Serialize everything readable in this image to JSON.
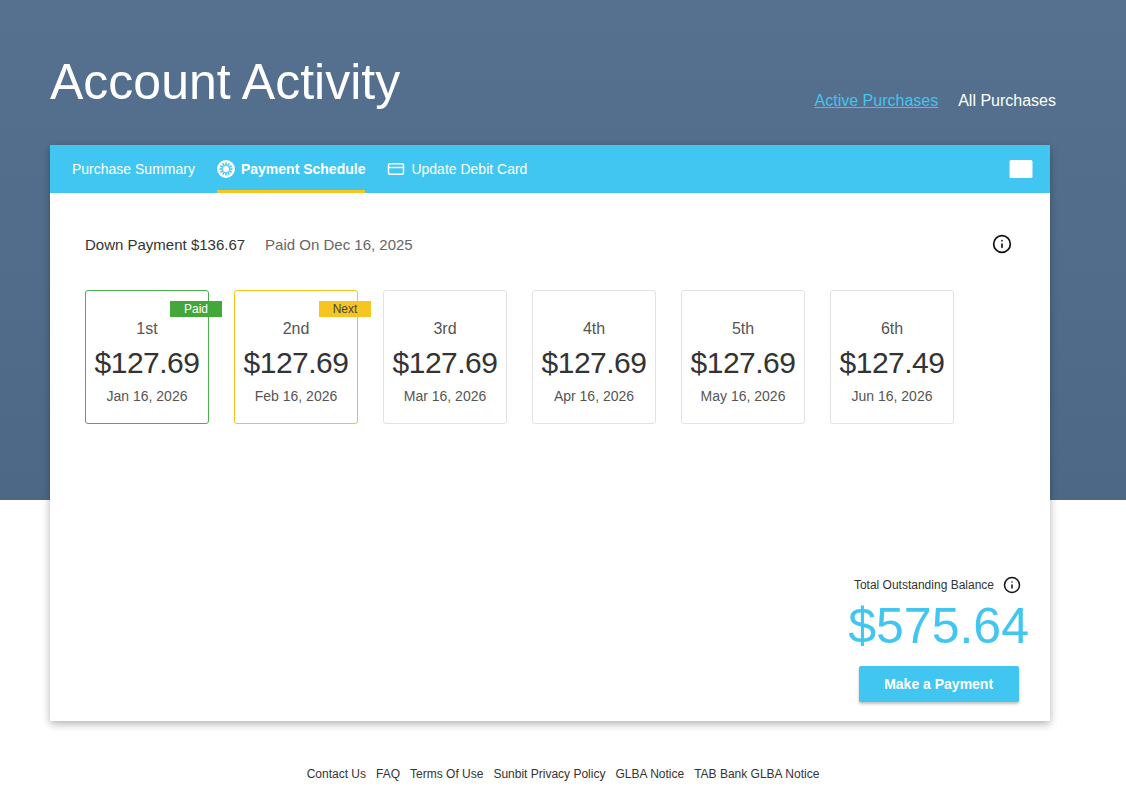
{
  "header": {
    "title": "Account Activity",
    "links": [
      {
        "label": "Active Purchases",
        "selected": true
      },
      {
        "label": "All Purchases",
        "selected": false
      }
    ]
  },
  "tabs": [
    {
      "label": "Purchase Summary",
      "selected": false,
      "icon": "none"
    },
    {
      "label": "Payment Schedule",
      "selected": true,
      "icon": "schedule"
    },
    {
      "label": "Update Debit Card",
      "selected": false,
      "icon": "card"
    }
  ],
  "down_payment": {
    "label": "Down Payment $136.67",
    "paid_on": "Paid On Dec 16, 2025"
  },
  "payments": [
    {
      "ordinal": "1st",
      "amount": "$127.69",
      "date": "Jan 16, 2026",
      "state": "paid",
      "badge": "Paid"
    },
    {
      "ordinal": "2nd",
      "amount": "$127.69",
      "date": "Feb 16, 2026",
      "state": "next",
      "badge": "Next"
    },
    {
      "ordinal": "3rd",
      "amount": "$127.69",
      "date": "Mar 16, 2026",
      "state": "upcoming",
      "badge": null
    },
    {
      "ordinal": "4th",
      "amount": "$127.69",
      "date": "Apr 16, 2026",
      "state": "upcoming",
      "badge": null
    },
    {
      "ordinal": "5th",
      "amount": "$127.69",
      "date": "May 16, 2026",
      "state": "upcoming",
      "badge": null
    },
    {
      "ordinal": "6th",
      "amount": "$127.49",
      "date": "Jun 16, 2026",
      "state": "upcoming",
      "badge": null
    }
  ],
  "balance": {
    "label": "Total Outstanding Balance",
    "amount": "$575.64"
  },
  "button": "Make a Payment",
  "footer": [
    "Contact Us",
    "FAQ",
    "Terms Of Use",
    "Sunbit Privacy Policy",
    "GLBA Notice",
    "TAB Bank GLBA Notice"
  ]
}
